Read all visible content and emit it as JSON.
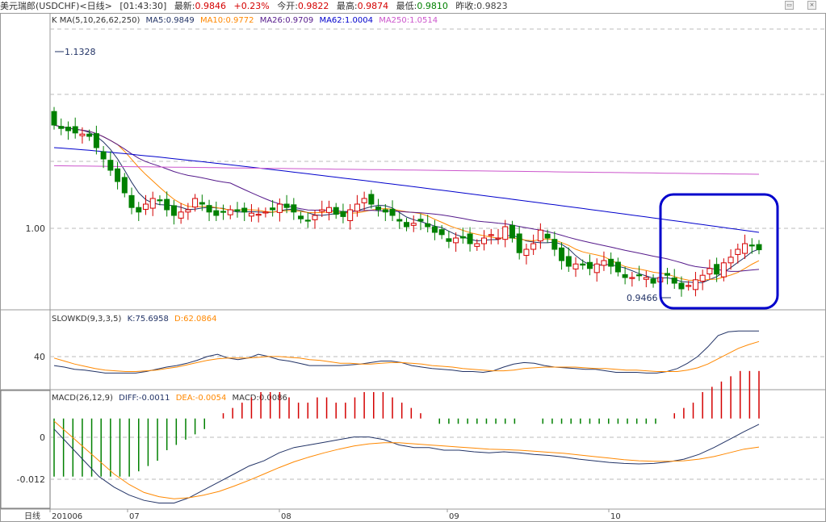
{
  "header": {
    "symbol": "美元瑞郎(USDCHF)<日线>",
    "time": "[01:43:30]",
    "last_label": "最新:",
    "last_value": "0.9846",
    "change": "+0.23%",
    "open_label": "今开:",
    "open_value": "0.9822",
    "high_label": "最高:",
    "high_value": "0.9874",
    "low_label": "最低:",
    "low_value": "0.9810",
    "prevclose_label": "昨收:",
    "prevclose_value": "0.9823"
  },
  "panels": {
    "price": {
      "legend_prefix": "K  MA(5,10,26,62,250)",
      "ma5": "MA5:0.9849",
      "ma10": "MA10:0.9772",
      "ma26": "MA26:0.9709",
      "ma62": "MA62:1.0004",
      "ma250": "MA250:1.0514",
      "ytick": "1.00",
      "max_label": "1.1328",
      "min_label": "0.9466"
    },
    "kd": {
      "legend_prefix": "SLOWKD(9,3,3,5)",
      "k": "K:75.6958",
      "d": "D:62.0864",
      "ytick": "40"
    },
    "macd": {
      "legend_prefix": "MACD(26,12,9)",
      "diff": "DIFF:-0.0011",
      "dea": "DEA:-0.0054",
      "macd": "MACD:0.0086",
      "ytick_top": "0",
      "ytick_bottom": "-0.012"
    }
  },
  "xaxis": {
    "label": "日线",
    "ticks": [
      "201006",
      "07",
      "08",
      "09",
      "10"
    ]
  },
  "colors": {
    "up": "#d40000",
    "down": "#008000",
    "ma5": "#223366",
    "ma10": "#ff8800",
    "ma26": "#551a8b",
    "ma62": "#0000cc",
    "ma250": "#cc55cc",
    "highlight": "#0000cc"
  },
  "chart_data": {
    "type": "candlestick",
    "title": "美元瑞郎(USDCHF)<日线>",
    "price_range": [
      0.935,
      1.18
    ],
    "x_ticks": [
      "201006",
      "07",
      "08",
      "09",
      "10"
    ],
    "close": [
      1.095,
      1.092,
      1.09,
      1.088,
      1.087,
      1.085,
      1.075,
      1.065,
      1.055,
      1.045,
      1.035,
      1.022,
      1.018,
      1.025,
      1.03,
      1.028,
      1.02,
      1.015,
      1.018,
      1.02,
      1.03,
      1.025,
      1.018,
      1.015,
      1.018,
      1.02,
      1.019,
      1.018,
      1.017,
      1.016,
      1.018,
      1.02,
      1.025,
      1.022,
      1.018,
      1.012,
      1.01,
      1.015,
      1.02,
      1.022,
      1.016,
      1.014,
      1.02,
      1.025,
      1.03,
      1.025,
      1.02,
      1.018,
      1.015,
      1.01,
      1.005,
      1.008,
      1.01,
      1.005,
      1.0,
      0.998,
      0.992,
      0.995,
      0.995,
      0.99,
      0.99,
      0.995,
      0.998,
      0.995,
      1.005,
      0.995,
      0.982,
      0.985,
      0.99,
      1.002,
      0.995,
      0.985,
      0.975,
      0.97,
      0.972,
      0.971,
      0.968,
      0.972,
      0.975,
      0.97,
      0.965,
      0.96,
      0.96,
      0.962,
      0.96,
      0.955,
      0.96,
      0.962,
      0.955,
      0.95,
      0.953,
      0.958,
      0.962,
      0.968,
      0.963,
      0.973,
      0.978,
      0.985,
      0.99,
      0.988,
      0.9846
    ],
    "kd_range": [
      0,
      100
    ],
    "slowkd_k": [
      30,
      28,
      25,
      24,
      22,
      20,
      20,
      20,
      20,
      22,
      25,
      28,
      30,
      33,
      37,
      42,
      45,
      40,
      38,
      40,
      45,
      42,
      38,
      36,
      33,
      30,
      30,
      30,
      30,
      31,
      32,
      34,
      36,
      36,
      34,
      30,
      28,
      26,
      25,
      24,
      22,
      22,
      21,
      23,
      28,
      32,
      34,
      33,
      30,
      28,
      27,
      26,
      25,
      25,
      23,
      21,
      21,
      21,
      20,
      20,
      22,
      26,
      33,
      42,
      55,
      70,
      75,
      76,
      76,
      76
    ],
    "slowkd_d": [
      40,
      36,
      32,
      29,
      26,
      24,
      23,
      22,
      22,
      23,
      24,
      26,
      28,
      31,
      34,
      37,
      39,
      40,
      40,
      40,
      41,
      42,
      42,
      41,
      40,
      38,
      37,
      35,
      33,
      33,
      32,
      32,
      33,
      34,
      34,
      33,
      32,
      30,
      29,
      28,
      26,
      25,
      24,
      23,
      23,
      24,
      26,
      27,
      28,
      28,
      28,
      28,
      27,
      26,
      26,
      25,
      24,
      24,
      23,
      22,
      22,
      22,
      24,
      27,
      32,
      39,
      46,
      53,
      58,
      62
    ],
    "macd_range": [
      -0.017,
      0.005
    ],
    "macd_diff": [
      -0.002,
      -0.005,
      -0.008,
      -0.011,
      -0.013,
      -0.0145,
      -0.0155,
      -0.016,
      -0.016,
      -0.015,
      -0.0135,
      -0.012,
      -0.0105,
      -0.009,
      -0.008,
      -0.0065,
      -0.0055,
      -0.005,
      -0.0045,
      -0.004,
      -0.0035,
      -0.0035,
      -0.004,
      -0.005,
      -0.0055,
      -0.0055,
      -0.006,
      -0.006,
      -0.0063,
      -0.0065,
      -0.0063,
      -0.0065,
      -0.0068,
      -0.007,
      -0.0073,
      -0.0077,
      -0.008,
      -0.0083,
      -0.0085,
      -0.0086,
      -0.0085,
      -0.0082,
      -0.0077,
      -0.0068,
      -0.0055,
      -0.004,
      -0.0025,
      -0.0011
    ],
    "macd_dea": [
      -0.0005,
      -0.003,
      -0.0055,
      -0.008,
      -0.0105,
      -0.0125,
      -0.014,
      -0.0148,
      -0.0152,
      -0.015,
      -0.0145,
      -0.0138,
      -0.0128,
      -0.0117,
      -0.0105,
      -0.0093,
      -0.0082,
      -0.0073,
      -0.0065,
      -0.0058,
      -0.0052,
      -0.0048,
      -0.0046,
      -0.0046,
      -0.0048,
      -0.005,
      -0.0052,
      -0.0054,
      -0.0056,
      -0.0058,
      -0.0059,
      -0.006,
      -0.0062,
      -0.0064,
      -0.0066,
      -0.0069,
      -0.0072,
      -0.0075,
      -0.0078,
      -0.008,
      -0.0081,
      -0.0081,
      -0.008,
      -0.0077,
      -0.0072,
      -0.0065,
      -0.0058,
      -0.0054
    ],
    "macd_hist": [
      -0.011,
      -0.011,
      -0.011,
      -0.011,
      -0.011,
      -0.011,
      -0.011,
      -0.011,
      -0.011,
      -0.01,
      -0.009,
      -0.008,
      -0.006,
      -0.005,
      -0.004,
      -0.003,
      -0.002,
      0.0,
      0.001,
      0.002,
      0.003,
      0.004,
      0.005,
      0.005,
      0.005,
      0.004,
      0.003,
      0.003,
      0.004,
      0.004,
      0.003,
      0.003,
      0.004,
      0.005,
      0.005,
      0.005,
      0.004,
      0.003,
      0.002,
      0.001,
      0.0,
      -0.001,
      -0.001,
      -0.001,
      -0.001,
      -0.001,
      -0.001,
      -0.001,
      -0.001,
      -0.001,
      0.0,
      0.0,
      -0.001,
      -0.001,
      -0.001,
      -0.001,
      -0.001,
      -0.001,
      -0.001,
      -0.001,
      -0.001,
      -0.001,
      -0.001,
      -0.001,
      -0.001,
      0.0,
      0.001,
      0.002,
      0.003,
      0.005,
      0.006,
      0.007,
      0.008,
      0.009,
      0.009,
      0.009
    ]
  }
}
